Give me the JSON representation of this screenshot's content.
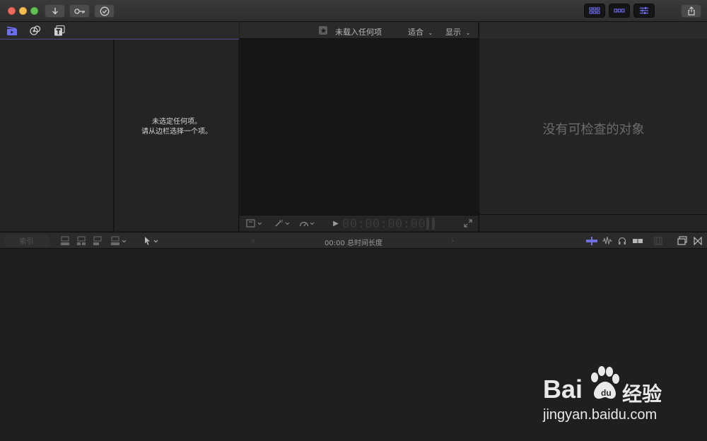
{
  "colors": {
    "accent": "#5a5ad6",
    "panel": "#242424",
    "viewer": "#161616",
    "titlebar": "#333333"
  },
  "titlebar": {
    "buttons": [
      "download-icon",
      "key-icon",
      "checkmark-circle-icon"
    ],
    "right_buttons": [
      "libraries-grid-icon",
      "timeline-grid-icon",
      "inspector-sliders-icon"
    ],
    "share": "share-icon"
  },
  "browser_tabs": [
    "clapper-icon",
    "photo-music-icon",
    "titles-icon"
  ],
  "browser": {
    "empty_line1": "未选定任何项。",
    "empty_line2": "请从边栏选择一个项。"
  },
  "viewer": {
    "header_status": "未载入任何项",
    "fit_label": "适合",
    "view_label": "显示",
    "timecode": "00:00:00:00"
  },
  "inspector": {
    "empty_message": "没有可检查的对象"
  },
  "timeline": {
    "index_label": "索引",
    "duration": "00:00 总时间长度"
  },
  "watermark": {
    "brand": "Bai",
    "brand_cn": "经验",
    "url": "jingyan.baidu.com"
  }
}
